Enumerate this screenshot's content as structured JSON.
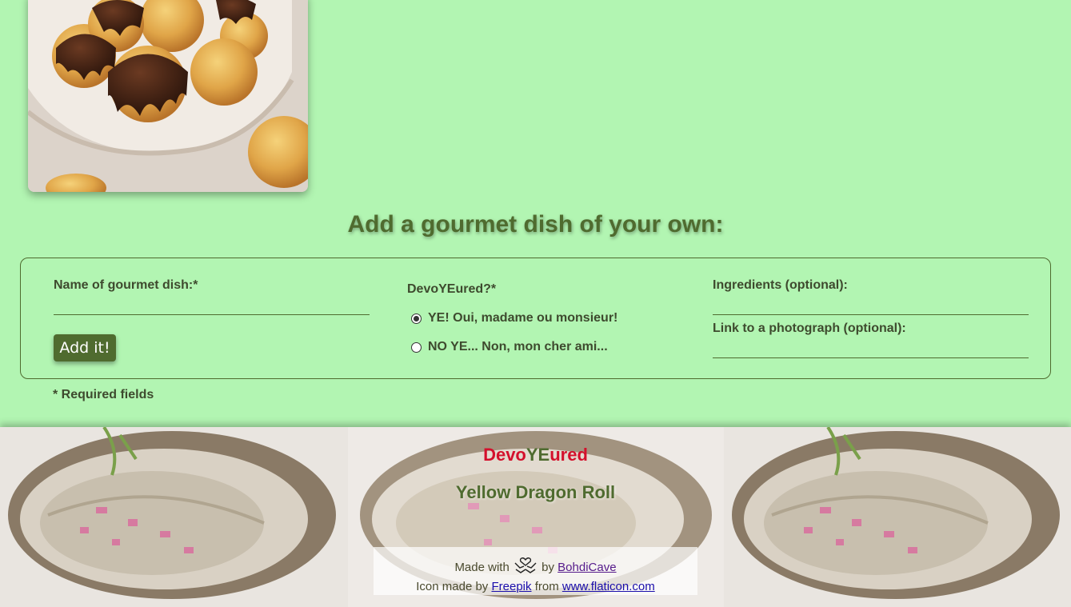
{
  "dish_photo": {
    "alt": "profiteroles",
    "icon": "profiteroles-photo"
  },
  "form": {
    "heading": "Add a gourmet dish of your own:",
    "name_label": "Name of gourmet dish:*",
    "name_value": "",
    "add_button": "Add it!",
    "devoyeured_label": "DevoYEured?*",
    "options": [
      {
        "label": "YE! Oui, madame ou monsieur!",
        "checked": true
      },
      {
        "label": "NO YE... Non, mon cher ami...",
        "checked": false
      }
    ],
    "ingredients_label": "Ingredients (optional):",
    "ingredients_value": "",
    "photo_link_label": "Link to a photograph (optional):",
    "photo_link_value": "",
    "required_note": "* Required fields"
  },
  "footer": {
    "brand_part1": "Devo",
    "brand_part2": "YE",
    "brand_part3": "ured",
    "dish_name": "Yellow Dragon Roll",
    "made_with": "Made with",
    "by": "by",
    "author_link": "BohdiCave",
    "icon_credit_prefix": "Icon made by",
    "icon_author_link": "Freepik",
    "from": "from",
    "icon_site_link": "www.flaticon.com",
    "love_icon": "hands-heart-icon"
  },
  "colors": {
    "background": "#b2f5b2",
    "accent_green": "#4f6b2f",
    "brand_red": "#d4102c",
    "text": "#3e4a2e"
  }
}
